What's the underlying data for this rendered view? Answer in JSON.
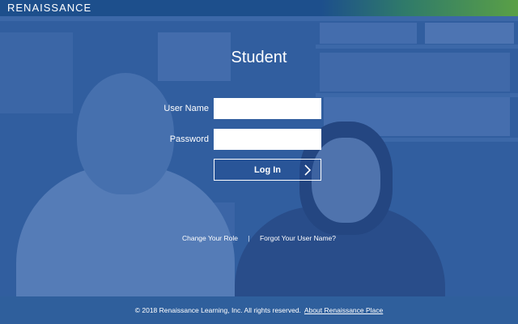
{
  "header": {
    "brand": "RENAISSANCE"
  },
  "login": {
    "title": "Student",
    "username_label": "User Name",
    "username_value": "",
    "password_label": "Password",
    "password_value": "",
    "submit_label": "Log In"
  },
  "links": {
    "change_role": "Change Your Role",
    "separator": "|",
    "forgot_username": "Forgot Your User Name?"
  },
  "footer": {
    "copyright": "© 2018 Renaissance Learning, Inc. All rights reserved.",
    "about_link": "About Renaissance Place"
  },
  "colors": {
    "brand_blue": "#1d4f8c",
    "accent_green": "#5aa046",
    "footer_blue": "#2f5f9c"
  }
}
